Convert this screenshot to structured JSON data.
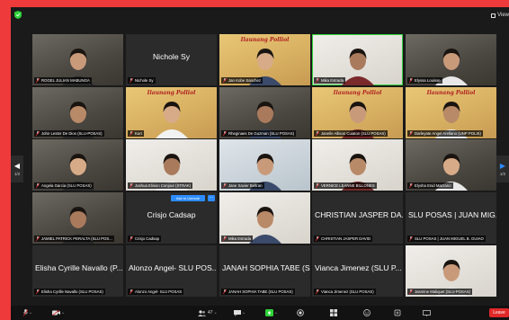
{
  "window": {
    "view_label": "View"
  },
  "banner_text": "Ilaunang Polliol",
  "pager": {
    "left": "1/2",
    "right": "1/2"
  },
  "tiles": [
    {
      "name": "ROGEL JULIAN MABUNGA",
      "type": "video"
    },
    {
      "name": "Nichole Sy",
      "type": "name",
      "big": "Nichole Sy"
    },
    {
      "name": "Jan Kobe Sanchez",
      "type": "yellow"
    },
    {
      "name": "Mika Estrada",
      "type": "white",
      "active": true
    },
    {
      "name": "Elyssa Louisse",
      "type": "video"
    },
    {
      "name": "John Lester De Dios (SLU-POSAS)",
      "type": "video"
    },
    {
      "name": "Kurt",
      "type": "yellow"
    },
    {
      "name": "Rheginaes De Guzman (SLU POSAS)",
      "type": "video"
    },
    {
      "name": "Janelle Allison Cuiaton (SLU POSAS)",
      "type": "yellow"
    },
    {
      "name": "Darleyate Angel Arellano (UNP POLIS)",
      "type": "yellow"
    },
    {
      "name": "Angela Garcia (SLU POSAS)",
      "type": "video"
    },
    {
      "name": "Joshua Elision Conjour (STRAK)",
      "type": "white"
    },
    {
      "name": "Jane Xavier Beltran",
      "type": "blue"
    },
    {
      "name": "VERNICE LEANNE BILLONES",
      "type": "white"
    },
    {
      "name": "Elysha Enid Marzano",
      "type": "video"
    },
    {
      "name": "JAMIEL PATRICK PERALTA (SLU POS...",
      "type": "video"
    },
    {
      "name": "Crisjo Cadsap",
      "type": "name",
      "big": "Crisjo Cadsap",
      "unmute": "Ask to Unmute",
      "more": "..."
    },
    {
      "name": "Mika Estrada",
      "type": "white"
    },
    {
      "name": "CHRISTIAN JASPER DAVID",
      "type": "name",
      "big": "CHRISTIAN JASPER DA..."
    },
    {
      "name": "SLU POSAS | JUAN MIGUEL B. GUIAO",
      "type": "name",
      "big": "SLU POSAS | JUAN MIG..."
    },
    {
      "name": "Elisha Cyrille Navallo (SLU POSAS)",
      "type": "name",
      "big": "Elisha Cyrille Navallo (P..."
    },
    {
      "name": "Alonzo Angel- SLU POSAS",
      "type": "name",
      "big": "Alonzo Angel- SLU POS..."
    },
    {
      "name": "JANAH SOPHIA TABE (SLU POSAS)",
      "type": "name",
      "big": "JANAH SOPHIA TABE (S..."
    },
    {
      "name": "Vianca Jimenez (SLU POSAS)",
      "type": "name",
      "big": "Vianca Jimenez (SLU P..."
    },
    {
      "name": "Jasmine Maliquet (SLU-POSAS)",
      "type": "white"
    }
  ],
  "toolbar": {
    "participants_count": "47",
    "leave_label": "Leave"
  },
  "colors": {
    "frame": "#ee3a3a",
    "active": "#2fd33a",
    "leave": "#e02828",
    "unmute": "#2d8cff"
  }
}
